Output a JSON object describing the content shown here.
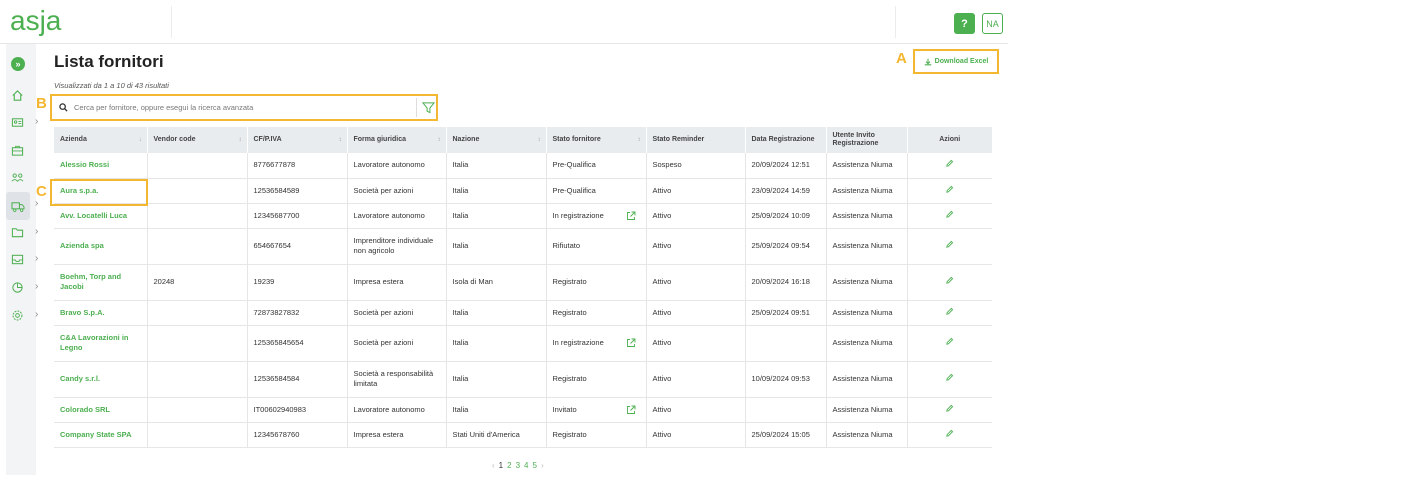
{
  "brand": {
    "logo_text": "asja",
    "accent": "#4caf50",
    "highlight": "#f4b731"
  },
  "header": {
    "help_label": "?",
    "avatar_initials": "NA"
  },
  "sidebar": {
    "expand_label": "»",
    "items": [
      {
        "icon": "home-icon"
      },
      {
        "icon": "id-card-icon",
        "has_submenu": true
      },
      {
        "icon": "briefcase-icon"
      },
      {
        "icon": "users-icon"
      },
      {
        "icon": "truck-icon",
        "has_submenu": true,
        "active": true
      },
      {
        "icon": "folder-icon",
        "has_submenu": true
      },
      {
        "icon": "inbox-icon",
        "has_submenu": true
      },
      {
        "icon": "chart-pie-icon",
        "has_submenu": true
      },
      {
        "icon": "gear-icon",
        "has_submenu": true
      }
    ]
  },
  "page": {
    "title": "Lista fornitori",
    "results_text": "Visualizzati da 1 a 10 di 43 risultati",
    "download_label": "Download Excel",
    "search_placeholder": "Cerca per fornitore, oppure esegui la ricerca avanzata"
  },
  "markers": {
    "a": "A",
    "b": "B",
    "c": "C"
  },
  "table": {
    "columns": [
      "Azienda",
      "Vendor code",
      "CF/P.IVA",
      "Forma giuridica",
      "Nazione",
      "Stato fornitore",
      "Stato Reminder",
      "Data Registrazione",
      "Utente Invito Registrazione",
      "Azioni"
    ],
    "rows": [
      [
        "Alessio Rossi",
        "",
        "8776677878",
        "Lavoratore autonomo",
        "Italia",
        "Pre-Qualifica",
        "Sospeso",
        "20/09/2024 12:51",
        "Assistenza Niuma"
      ],
      [
        "Aura s.p.a.",
        "",
        "12536584589",
        "Società per azioni",
        "Italia",
        "Pre-Qualifica",
        "Attivo",
        "23/09/2024 14:59",
        "Assistenza Niuma"
      ],
      [
        "Avv. Locatelli Luca",
        "",
        "12345687700",
        "Lavoratore autonomo",
        "Italia",
        "In registrazione",
        "Attivo",
        "25/09/2024 10:09",
        "Assistenza Niuma"
      ],
      [
        "Azienda spa",
        "",
        "654667654",
        "Imprenditore individuale non agricolo",
        "Italia",
        "Rifiutato",
        "Attivo",
        "25/09/2024 09:54",
        "Assistenza Niuma"
      ],
      [
        "Boehm, Torp and Jacobi",
        "20248",
        "19239",
        "Impresa estera",
        "Isola di Man",
        "Registrato",
        "Attivo",
        "20/09/2024 16:18",
        "Assistenza Niuma"
      ],
      [
        "Bravo S.p.A.",
        "",
        "72873827832",
        "Società per azioni",
        "Italia",
        "Registrato",
        "Attivo",
        "25/09/2024 09:51",
        "Assistenza Niuma"
      ],
      [
        "C&A Lavorazioni in Legno",
        "",
        "12536584565​4",
        "Società per azioni",
        "Italia",
        "In registrazione",
        "Attivo",
        "",
        "Assistenza Niuma"
      ],
      [
        "Candy s.r.l.",
        "",
        "12536584584",
        "Società a responsabilità limitata",
        "Italia",
        "Registrato",
        "Attivo",
        "10/09/2024 09:53",
        "Assistenza Niuma"
      ],
      [
        "Colorado SRL",
        "",
        "IT00602940983",
        "Lavoratore autonomo",
        "Italia",
        "Invitato",
        "Attivo",
        "",
        "Assistenza Niuma"
      ],
      [
        "Company State SPA",
        "",
        "12345678760",
        "Impresa estera",
        "Stati Uniti d'America",
        "Registrato",
        "Attivo",
        "25/09/2024 15:05",
        "Assistenza Niuma"
      ]
    ],
    "external_link_rows": [
      2,
      6,
      8
    ]
  },
  "pagination": {
    "prev": "‹",
    "pages": [
      "1",
      "2",
      "3",
      "4",
      "5"
    ],
    "current": "1",
    "next": "›"
  }
}
